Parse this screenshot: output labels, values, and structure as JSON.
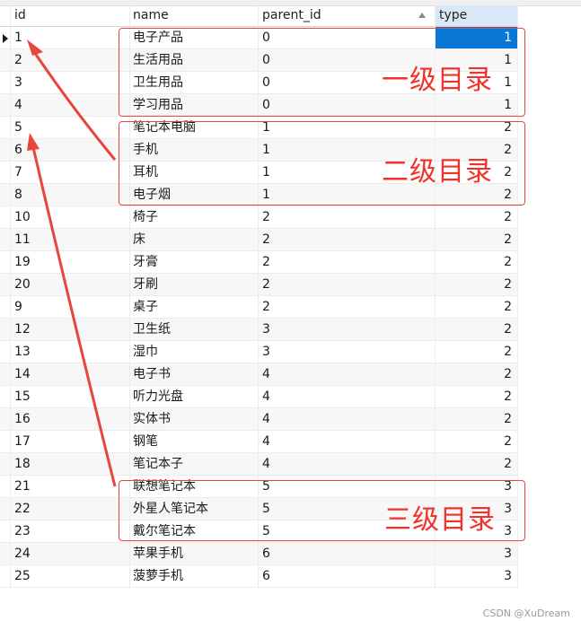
{
  "columns": [
    {
      "key": "id",
      "label": "id"
    },
    {
      "key": "name",
      "label": "name"
    },
    {
      "key": "parent_id",
      "label": "parent_id",
      "sorted": "ascending"
    },
    {
      "key": "type",
      "label": "type"
    }
  ],
  "rows": [
    {
      "id": "1",
      "name": "电子产品",
      "parent_id": "0",
      "type": "1",
      "selected_cell": "type"
    },
    {
      "id": "2",
      "name": "生活用品",
      "parent_id": "0",
      "type": "1"
    },
    {
      "id": "3",
      "name": "卫生用品",
      "parent_id": "0",
      "type": "1"
    },
    {
      "id": "4",
      "name": "学习用品",
      "parent_id": "0",
      "type": "1"
    },
    {
      "id": "5",
      "name": "笔记本电脑",
      "parent_id": "1",
      "type": "2"
    },
    {
      "id": "6",
      "name": "手机",
      "parent_id": "1",
      "type": "2"
    },
    {
      "id": "7",
      "name": "耳机",
      "parent_id": "1",
      "type": "2"
    },
    {
      "id": "8",
      "name": "电子烟",
      "parent_id": "1",
      "type": "2"
    },
    {
      "id": "10",
      "name": "椅子",
      "parent_id": "2",
      "type": "2"
    },
    {
      "id": "11",
      "name": "床",
      "parent_id": "2",
      "type": "2"
    },
    {
      "id": "19",
      "name": "牙膏",
      "parent_id": "2",
      "type": "2"
    },
    {
      "id": "20",
      "name": "牙刷",
      "parent_id": "2",
      "type": "2"
    },
    {
      "id": "9",
      "name": "桌子",
      "parent_id": "2",
      "type": "2"
    },
    {
      "id": "12",
      "name": "卫生纸",
      "parent_id": "3",
      "type": "2"
    },
    {
      "id": "13",
      "name": "湿巾",
      "parent_id": "3",
      "type": "2"
    },
    {
      "id": "14",
      "name": "电子书",
      "parent_id": "4",
      "type": "2"
    },
    {
      "id": "15",
      "name": "听力光盘",
      "parent_id": "4",
      "type": "2"
    },
    {
      "id": "16",
      "name": "实体书",
      "parent_id": "4",
      "type": "2"
    },
    {
      "id": "17",
      "name": "钢笔",
      "parent_id": "4",
      "type": "2"
    },
    {
      "id": "18",
      "name": "笔记本子",
      "parent_id": "4",
      "type": "2"
    },
    {
      "id": "21",
      "name": "联想笔记本",
      "parent_id": "5",
      "type": "3"
    },
    {
      "id": "22",
      "name": "外星人笔记本",
      "parent_id": "5",
      "type": "3"
    },
    {
      "id": "23",
      "name": "戴尔笔记本",
      "parent_id": "5",
      "type": "3"
    },
    {
      "id": "24",
      "name": "苹果手机",
      "parent_id": "6",
      "type": "3"
    },
    {
      "id": "25",
      "name": "菠萝手机",
      "parent_id": "6",
      "type": "3"
    }
  ],
  "annotations": {
    "level1": "一级目录",
    "level2": "二级目录",
    "level3": "三级目录",
    "color": "#e8453c"
  },
  "watermark": "CSDN @XuDream"
}
